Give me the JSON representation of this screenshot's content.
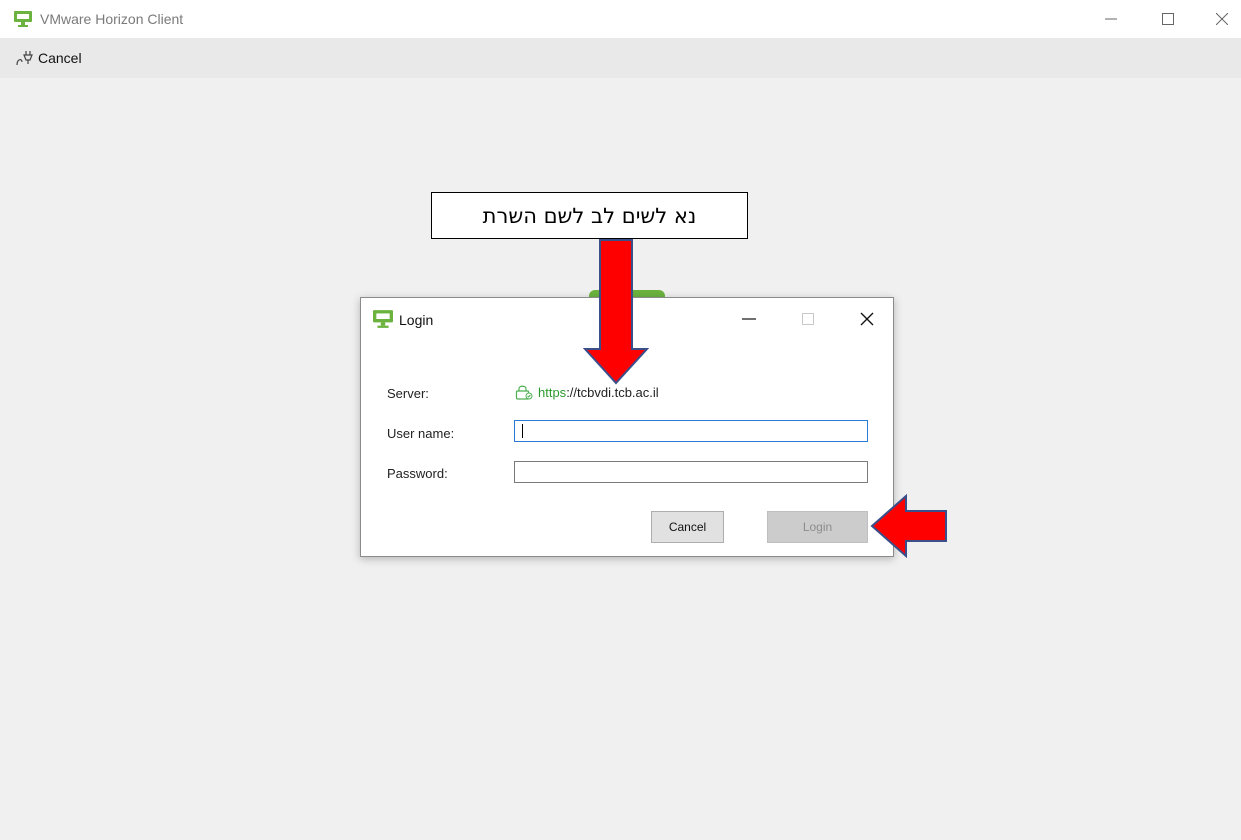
{
  "app": {
    "title": "VMware Horizon Client"
  },
  "toolbar": {
    "cancel_label": "Cancel"
  },
  "dialog": {
    "title": "Login",
    "server_label": "Server:",
    "server_scheme": "https",
    "server_rest": "://tcbvdi.tcb.ac.il",
    "username_label": "User name:",
    "username_value": "",
    "password_label": "Password:",
    "password_value": "",
    "cancel_label": "Cancel",
    "login_label": "Login"
  },
  "annotation": {
    "text": "נא לשים לב לשם השרת"
  },
  "colors": {
    "brand_green": "#6bb33e",
    "arrow_red": "#ff0000",
    "focus_blue": "#2b7bd6"
  }
}
